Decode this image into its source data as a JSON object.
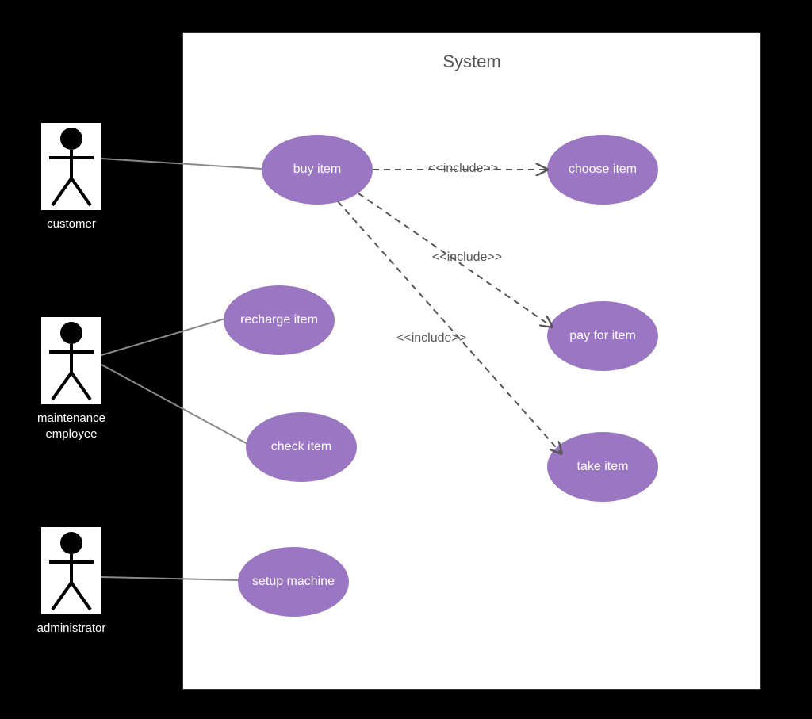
{
  "system": {
    "title": "System"
  },
  "actors": {
    "customer": {
      "label": "customer"
    },
    "maintenance": {
      "label": "maintenance employee"
    },
    "administrator": {
      "label": "administrator"
    }
  },
  "usecases": {
    "buy": {
      "label": "buy item"
    },
    "choose": {
      "label": "choose item"
    },
    "pay": {
      "label": "pay for item"
    },
    "take": {
      "label": "take item"
    },
    "recharge": {
      "label": "recharge item"
    },
    "check": {
      "label": "check item"
    },
    "setup": {
      "label": "setup machine"
    }
  },
  "relations": {
    "include1": {
      "label": "<<include>>"
    },
    "include2": {
      "label": "<<include>>"
    },
    "include3": {
      "label": "<<include>>"
    }
  }
}
